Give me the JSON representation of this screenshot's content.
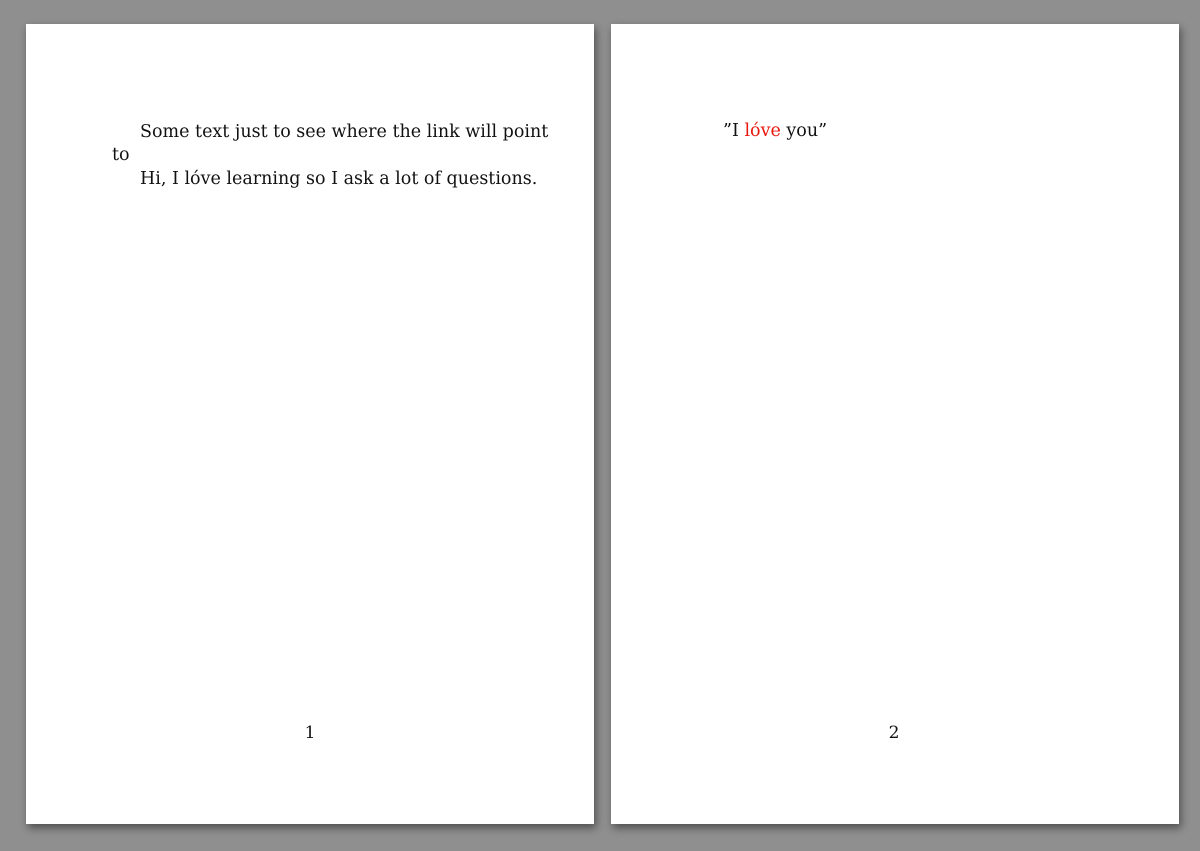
{
  "pages": [
    {
      "lines": [
        "Some text just to see where the link will point",
        "Hi, I lóve learning so I ask a lot of questions."
      ],
      "margin_note": "to",
      "page_number": "1"
    },
    {
      "quote": {
        "open": "”I ",
        "highlight": "lóve",
        "close": " you”"
      },
      "page_number": "2"
    }
  ],
  "colors": {
    "background": "#8f8f8f",
    "page": "#ffffff",
    "text": "#111111",
    "highlight": "#e8160c"
  }
}
